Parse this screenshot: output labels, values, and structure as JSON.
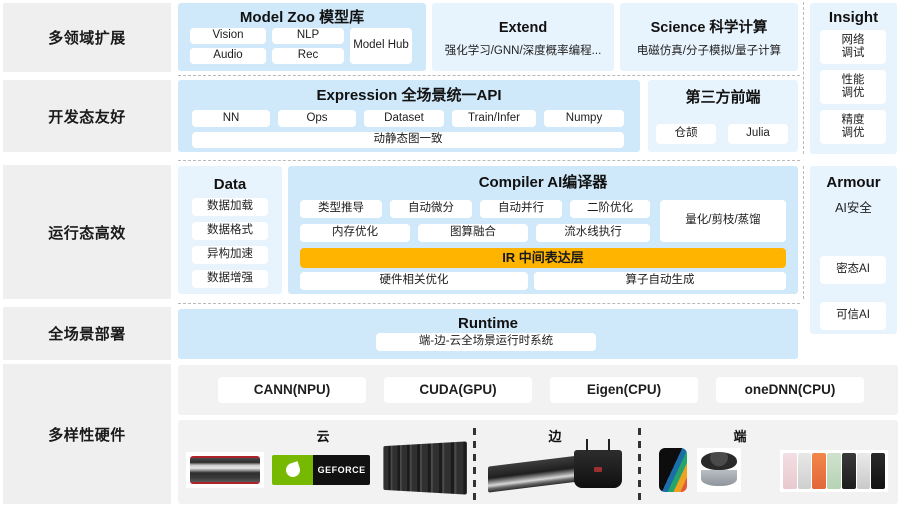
{
  "layers": [
    {
      "label": "多领域扩展"
    },
    {
      "label": "开发态友好"
    },
    {
      "label": "运行态高效"
    },
    {
      "label": "全场景部署"
    },
    {
      "label": "多样性硬件"
    }
  ],
  "model_zoo": {
    "title": "Model Zoo 模型库",
    "chips": [
      "Vision",
      "NLP",
      "Audio",
      "Rec"
    ],
    "hub": "Model Hub"
  },
  "extend": {
    "title": "Extend",
    "subtitle": "强化学习/GNN/深度概率编程..."
  },
  "science": {
    "title": "Science 科学计算",
    "subtitle": "电磁仿真/分子模拟/量子计算"
  },
  "insight": {
    "title": "Insight",
    "chips": [
      "网络\n调试",
      "性能\n调优",
      "精度\n调优"
    ]
  },
  "expression": {
    "title": "Expression 全场景统一API",
    "chips": [
      "NN",
      "Ops",
      "Dataset",
      "Train/Infer",
      "Numpy"
    ],
    "wide_chip": "动静态图一致"
  },
  "third_party": {
    "title": "第三方前端",
    "chips": [
      "仓颉",
      "Julia"
    ]
  },
  "data_column": {
    "title": "Data",
    "chips": [
      "数据加载",
      "数据格式",
      "异构加速",
      "数据增强"
    ]
  },
  "compiler": {
    "title": "Compiler AI编译器",
    "row1": [
      "类型推导",
      "自动微分",
      "自动并行",
      "二阶优化"
    ],
    "row2": [
      "内存优化",
      "图算融合",
      "流水线执行"
    ],
    "side_chip": "量化/剪枝/蒸馏",
    "ir_bar": "IR 中间表达层",
    "row3": [
      "硬件相关优化",
      "算子自动生成"
    ]
  },
  "armour": {
    "title": "Armour",
    "subtitle": "AI安全",
    "chips": [
      "密态AI",
      "可信AI"
    ]
  },
  "runtime": {
    "title": "Runtime",
    "chip": "端-边-云全场景运行时系统"
  },
  "backends": [
    "CANN(NPU)",
    "CUDA(GPU)",
    "Eigen(CPU)",
    "oneDNN(CPU)"
  ],
  "hardware": {
    "zones": [
      "云",
      "边",
      "端"
    ],
    "devices": {
      "cloud": [
        "server-chassis",
        "nvidia-geforce-badge",
        "server-rack"
      ],
      "edge": [
        "gpu-accelerator-card",
        "edge-router-box"
      ],
      "device": [
        "smartphone",
        "wireless-earbuds",
        "smart-watch-bands"
      ]
    },
    "geforce_text": "GEFORCE",
    "nvidia_text": "nvidia"
  },
  "colors": {
    "layer_label_bg": "#efefef",
    "panel_blue": "#cfe9fb",
    "panel_pale_blue": "#e8f4fd",
    "ir_orange": "#ffb400",
    "chip_white": "#ffffff",
    "hardware_bg": "#f2f2f2",
    "nvidia_green": "#76b900"
  }
}
